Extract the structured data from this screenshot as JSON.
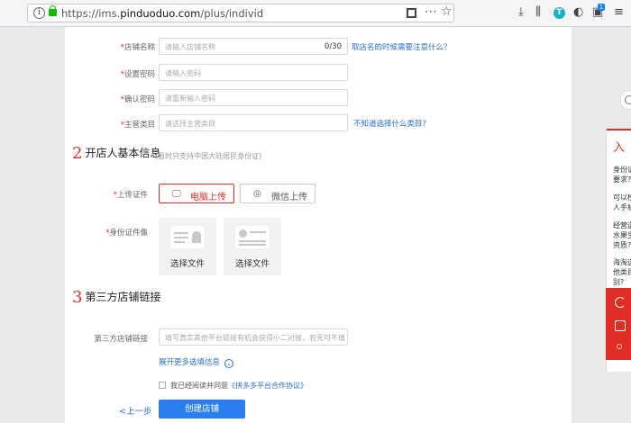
{
  "browser": {
    "url_domain": "pinduoduo.com",
    "url_prefix": "https://ims.",
    "url_path": "/plus/individ",
    "badge_count": "1"
  },
  "account": {
    "store_name_label": "店铺名称",
    "store_name_placeholder": "请输入店铺名称",
    "store_name_count": "0/30",
    "store_name_help": "取店名的时候需要注意什么？",
    "password_label": "设置密码",
    "password_placeholder": "请输入密码",
    "confirm_label": "确认密码",
    "confirm_placeholder": "请重新输入密码",
    "category_label": "主营类目",
    "category_placeholder": "请选择主营类目",
    "category_help": "不知道选择什么类目?"
  },
  "section2": {
    "number": "2",
    "title": "开店人基本信息",
    "subtitle": "(暂时只支持中国大陆居民身份证)",
    "upload_label": "上传证件",
    "pc_upload": "电脑上传",
    "wechat_upload": "微信上传",
    "idphoto_label": "身份证件像",
    "choose_front": "选择文件",
    "choose_back": "选择文件"
  },
  "section3": {
    "number": "3",
    "title": "第三方店铺链接",
    "link_label": "第三方店铺链接",
    "link_placeholder": "填写真实其他平台链接有机会获得小二对接，若无可不填",
    "expand": "展开更多选填信息",
    "agree_prefix": "我已经阅读并同意",
    "agree_link": "《拼多多平台合作协议》"
  },
  "actions": {
    "prev": "<上一步",
    "create": "创建店铺"
  },
  "float": {
    "head": "入",
    "questions": [
      "身份证",
      "要求?",
      "可以榜",
      "人手机",
      "经营选",
      "水果生",
      "资质?",
      "海淘选",
      "他类目",
      "别?"
    ]
  }
}
